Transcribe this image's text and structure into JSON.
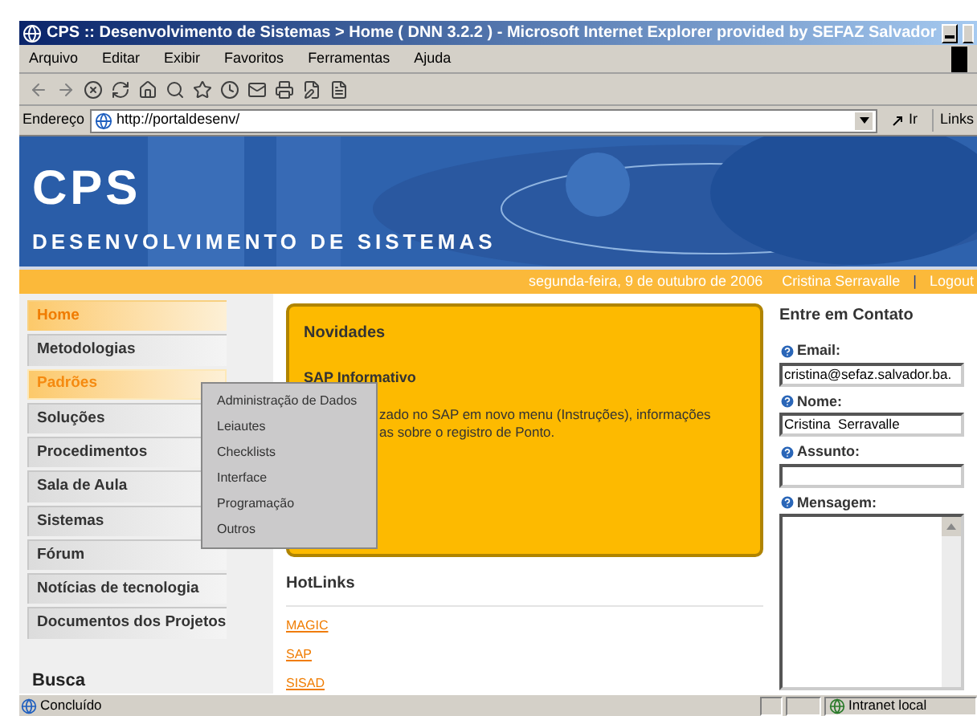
{
  "window": {
    "title": "CPS :: Desenvolvimento de Sistemas > Home ( DNN 3.2.2 ) - Microsoft Internet Explorer provided by SEFAZ Salvador"
  },
  "menu_bar": [
    "Arquivo",
    "Editar",
    "Exibir",
    "Favoritos",
    "Ferramentas",
    "Ajuda"
  ],
  "address_bar": {
    "label": "Endereço",
    "value": "http://portaldesenv/",
    "go": "Ir",
    "links": "Links"
  },
  "banner": {
    "logo": "CPS",
    "subtitle": "DESENVOLVIMENTO DE SISTEMAS"
  },
  "info_bar": {
    "date": "segunda-feira, 9 de outubro de 2006",
    "user": "Cristina Serravalle",
    "separator": "|",
    "logout": "Logout"
  },
  "nav": [
    {
      "label": "Home",
      "selected": true,
      "expanded": false
    },
    {
      "label": "Metodologias",
      "selected": false,
      "expanded": false
    },
    {
      "label": "Padrões",
      "selected": false,
      "expanded": true
    },
    {
      "label": "Soluções",
      "selected": false,
      "expanded": false
    },
    {
      "label": "Procedimentos",
      "selected": false,
      "expanded": false
    },
    {
      "label": "Sala de Aula",
      "selected": false,
      "expanded": false
    },
    {
      "label": "Sistemas",
      "selected": false,
      "expanded": false
    },
    {
      "label": "Fórum",
      "selected": false,
      "expanded": false
    },
    {
      "label": "Notícias de tecnologia",
      "selected": false,
      "expanded": false
    },
    {
      "label": "Documentos dos Projetos",
      "selected": false,
      "expanded": false
    }
  ],
  "submenu": [
    "Administração de Dados",
    "Leiautes",
    "Checklists",
    "Interface",
    "Programação",
    "Outros"
  ],
  "search_title": "Busca",
  "news": {
    "title": "Novidades",
    "item_title": "SAP Informativo",
    "item_lines": [
      "zado no SAP em novo menu (Instruções), informações",
      "as sobre o registro de Ponto."
    ]
  },
  "hotlinks": {
    "title": "HotLinks",
    "links": [
      "MAGIC",
      "SAP",
      "SISAD"
    ]
  },
  "contact": {
    "title": "Entre em Contato",
    "fields": [
      {
        "label": "Email:",
        "value": "cristina@sefaz.salvador.ba.",
        "kind": "input"
      },
      {
        "label": "Nome:",
        "value": "Cristina  Serravalle",
        "kind": "input"
      },
      {
        "label": "Assunto:",
        "kind": "input"
      },
      {
        "label": "Mensagem:",
        "kind": "textarea"
      }
    ]
  },
  "status_bar": {
    "text": "Concluído",
    "zone": "Intranet local"
  }
}
